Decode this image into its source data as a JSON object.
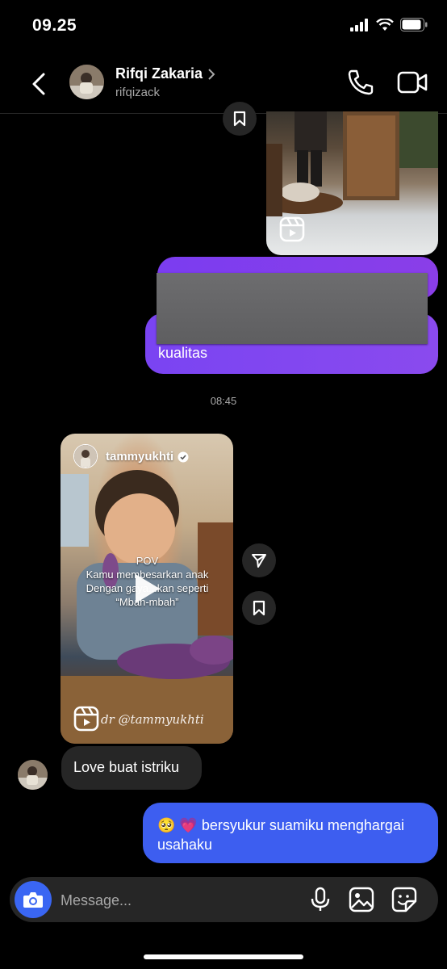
{
  "status_bar": {
    "time": "09.25"
  },
  "header": {
    "name": "Rifqi Zakaria",
    "username": "rifqizack"
  },
  "messages": {
    "sent_text_1": "kualitas",
    "timestamp": "08:45",
    "reel": {
      "username": "tammyukhti",
      "caption_line1": "POV",
      "caption_line2": "Kamu membesarkan anak",
      "caption_line3": "Dengan gaya...kan seperti",
      "caption_line4": "“Mbah-mbah”",
      "credit": "dr @tammyukhti"
    },
    "received_text": "Love buat istriku",
    "sent_text_2": "🥺 💗 bersyukur suamiku menghargai usahaku"
  },
  "composer": {
    "placeholder": "Message..."
  },
  "colors": {
    "purple": "#7b3df0",
    "blue": "#3d5ef0",
    "received": "#262626",
    "camera": "#3a66f3"
  },
  "icons": [
    "back-icon",
    "chevron-right-icon",
    "phone-icon",
    "video-camera-icon",
    "bookmark-icon",
    "reels-icon",
    "play-icon",
    "send-icon",
    "verified-icon",
    "camera-icon",
    "microphone-icon",
    "gallery-icon",
    "sticker-icon"
  ]
}
